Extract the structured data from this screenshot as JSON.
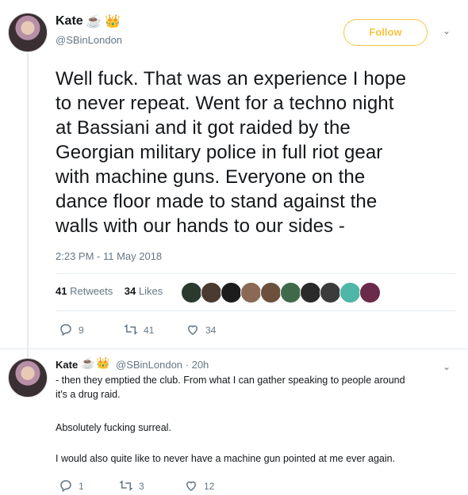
{
  "tweet": {
    "author_name": "Kate",
    "emojis": [
      "coffee-emoji",
      "crown-emoji"
    ],
    "handle": "@SBinLondon",
    "follow_label": "Follow",
    "text_lines": [
      "Well fuck. That was an experience I hope",
      "to never repeat. Went for a techno night",
      "at Bassiani and it got raided by the",
      "Georgian military police in full riot gear",
      "with machine guns. Everyone on the",
      "dance floor made to stand against the",
      "walls with our hands to our sides -"
    ],
    "timestamp": "2:23 PM - 11 May 2018",
    "retweets_count": "41",
    "retweets_label": "Retweets",
    "likes_count": "34",
    "likes_label": "Likes",
    "likers": [
      "#2b3a2e",
      "#4a3a30",
      "#1c1c1c",
      "#8a6a55",
      "#6c4f3c",
      "#3f6a4a",
      "#2a2a2a",
      "#3b3b3b",
      "#4fb6a8",
      "#6a2a4a"
    ],
    "actions": {
      "reply": "9",
      "retweet": "41",
      "like": "34"
    },
    "accent_color": "#f7c43f"
  },
  "reply": {
    "author_name": "Kate",
    "handle_time": "@SBinLondon · 20h",
    "paragraphs": [
      "- then they emptied the club. From what I can gather speaking to people around",
      "it's a drug raid.",
      "Absolutely fucking surreal.",
      "I would also quite like to never have a machine gun pointed at me ever again."
    ],
    "actions": {
      "reply": "1",
      "retweet": "3",
      "like": "12"
    }
  }
}
